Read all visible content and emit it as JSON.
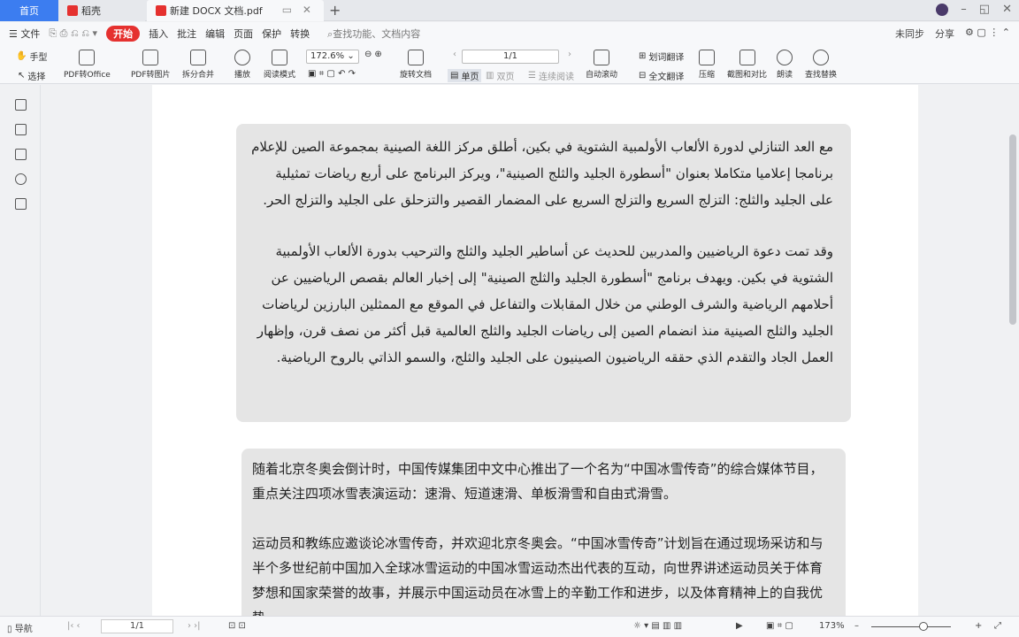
{
  "titlebar": {
    "tabs": [
      {
        "label": "首页"
      },
      {
        "label": "稻壳"
      },
      {
        "label": "新建 DOCX 文档.pdf"
      }
    ],
    "new_tab": "+",
    "window_controls": [
      "–",
      "◱",
      "✕"
    ]
  },
  "menubar": {
    "file": "☰ 文件",
    "start": "开始",
    "items": [
      "插入",
      "批注",
      "编辑",
      "页面",
      "保护",
      "转换"
    ],
    "search": "查找功能、文档内容",
    "right": [
      "未同步",
      "分享"
    ]
  },
  "ribbon": {
    "hand": "手型",
    "select": "选择",
    "pdf_to_office": "PDF转Office",
    "pdf_to_image": "PDF转图片",
    "split_merge": "拆分合并",
    "play": "播放",
    "read_mode": "阅读模式",
    "zoom": "172.6%",
    "rotate": "旋转文档",
    "single_page": "单页",
    "double_page": "双页",
    "continuous": "连续阅读",
    "auto_scroll": "自动滚动",
    "page_display": "1/1",
    "translate_word": "划词翻译",
    "translate_full": "全文翻译",
    "compress": "压缩",
    "screenshot": "截图和对比",
    "read_aloud": "朗读",
    "find_replace": "查找替换"
  },
  "document": {
    "arabic_paragraphs": [
      "مع العد التنازلي لدورة الألعاب الأولمبية الشتوية في بكين، أطلق مركز اللغة الصينية بمجموعة الصين للإعلام برنامجا إعلاميا متكاملا بعنوان \"أسطورة الجليد والثلج الصينية\"، ويركز البرنامج على أربع رياضات تمثيلية على الجليد والثلج: التزلج السريع والتزلج السريع على المضمار القصير والتزحلق على الجليد والتزلج الحر.",
      "وقد تمت دعوة الرياضيين والمدربين للحديث عن أساطير الجليد والثلج والترحيب بدورة الألعاب الأولمبية الشتوية في بكين. ويهدف برنامج \"أسطورة الجليد والثلج الصينية\" إلى إخبار العالم بقصص الرياضيين عن أحلامهم الرياضية والشرف الوطني من خلال المقابلات والتفاعل في الموقع مع الممثلين البارزين لرياضات الجليد والثلج الصينية منذ انضمام الصين إلى رياضات الجليد والثلج العالمية قبل أكثر من نصف قرن، وإظهار العمل الجاد والتقدم الذي حققه الرياضيون الصينيون على الجليد والثلج، والسمو الذاتي بالروح الرياضية."
    ],
    "chinese_paragraphs": [
      "随着北京冬奥会倒计时，中国传媒集团中文中心推出了一个名为“中国冰雪传奇”的综合媒体节目，重点关注四项冰雪表演运动：速滑、短道速滑、单板滑雪和自由式滑雪。",
      "运动员和教练应邀谈论冰雪传奇，并欢迎北京冬奥会。“中国冰雪传奇”计划旨在通过现场采访和与半个多世纪前中国加入全球冰雪运动的中国冰雪运动杰出代表的互动，向世界讲述运动员关于体育梦想和国家荣誉的故事，并展示中国运动员在冰雪上的辛勤工作和进步，以及体育精神上的自我优势。"
    ]
  },
  "statusbar": {
    "nav": "导航",
    "page": "1/1",
    "zoom": "173%"
  }
}
